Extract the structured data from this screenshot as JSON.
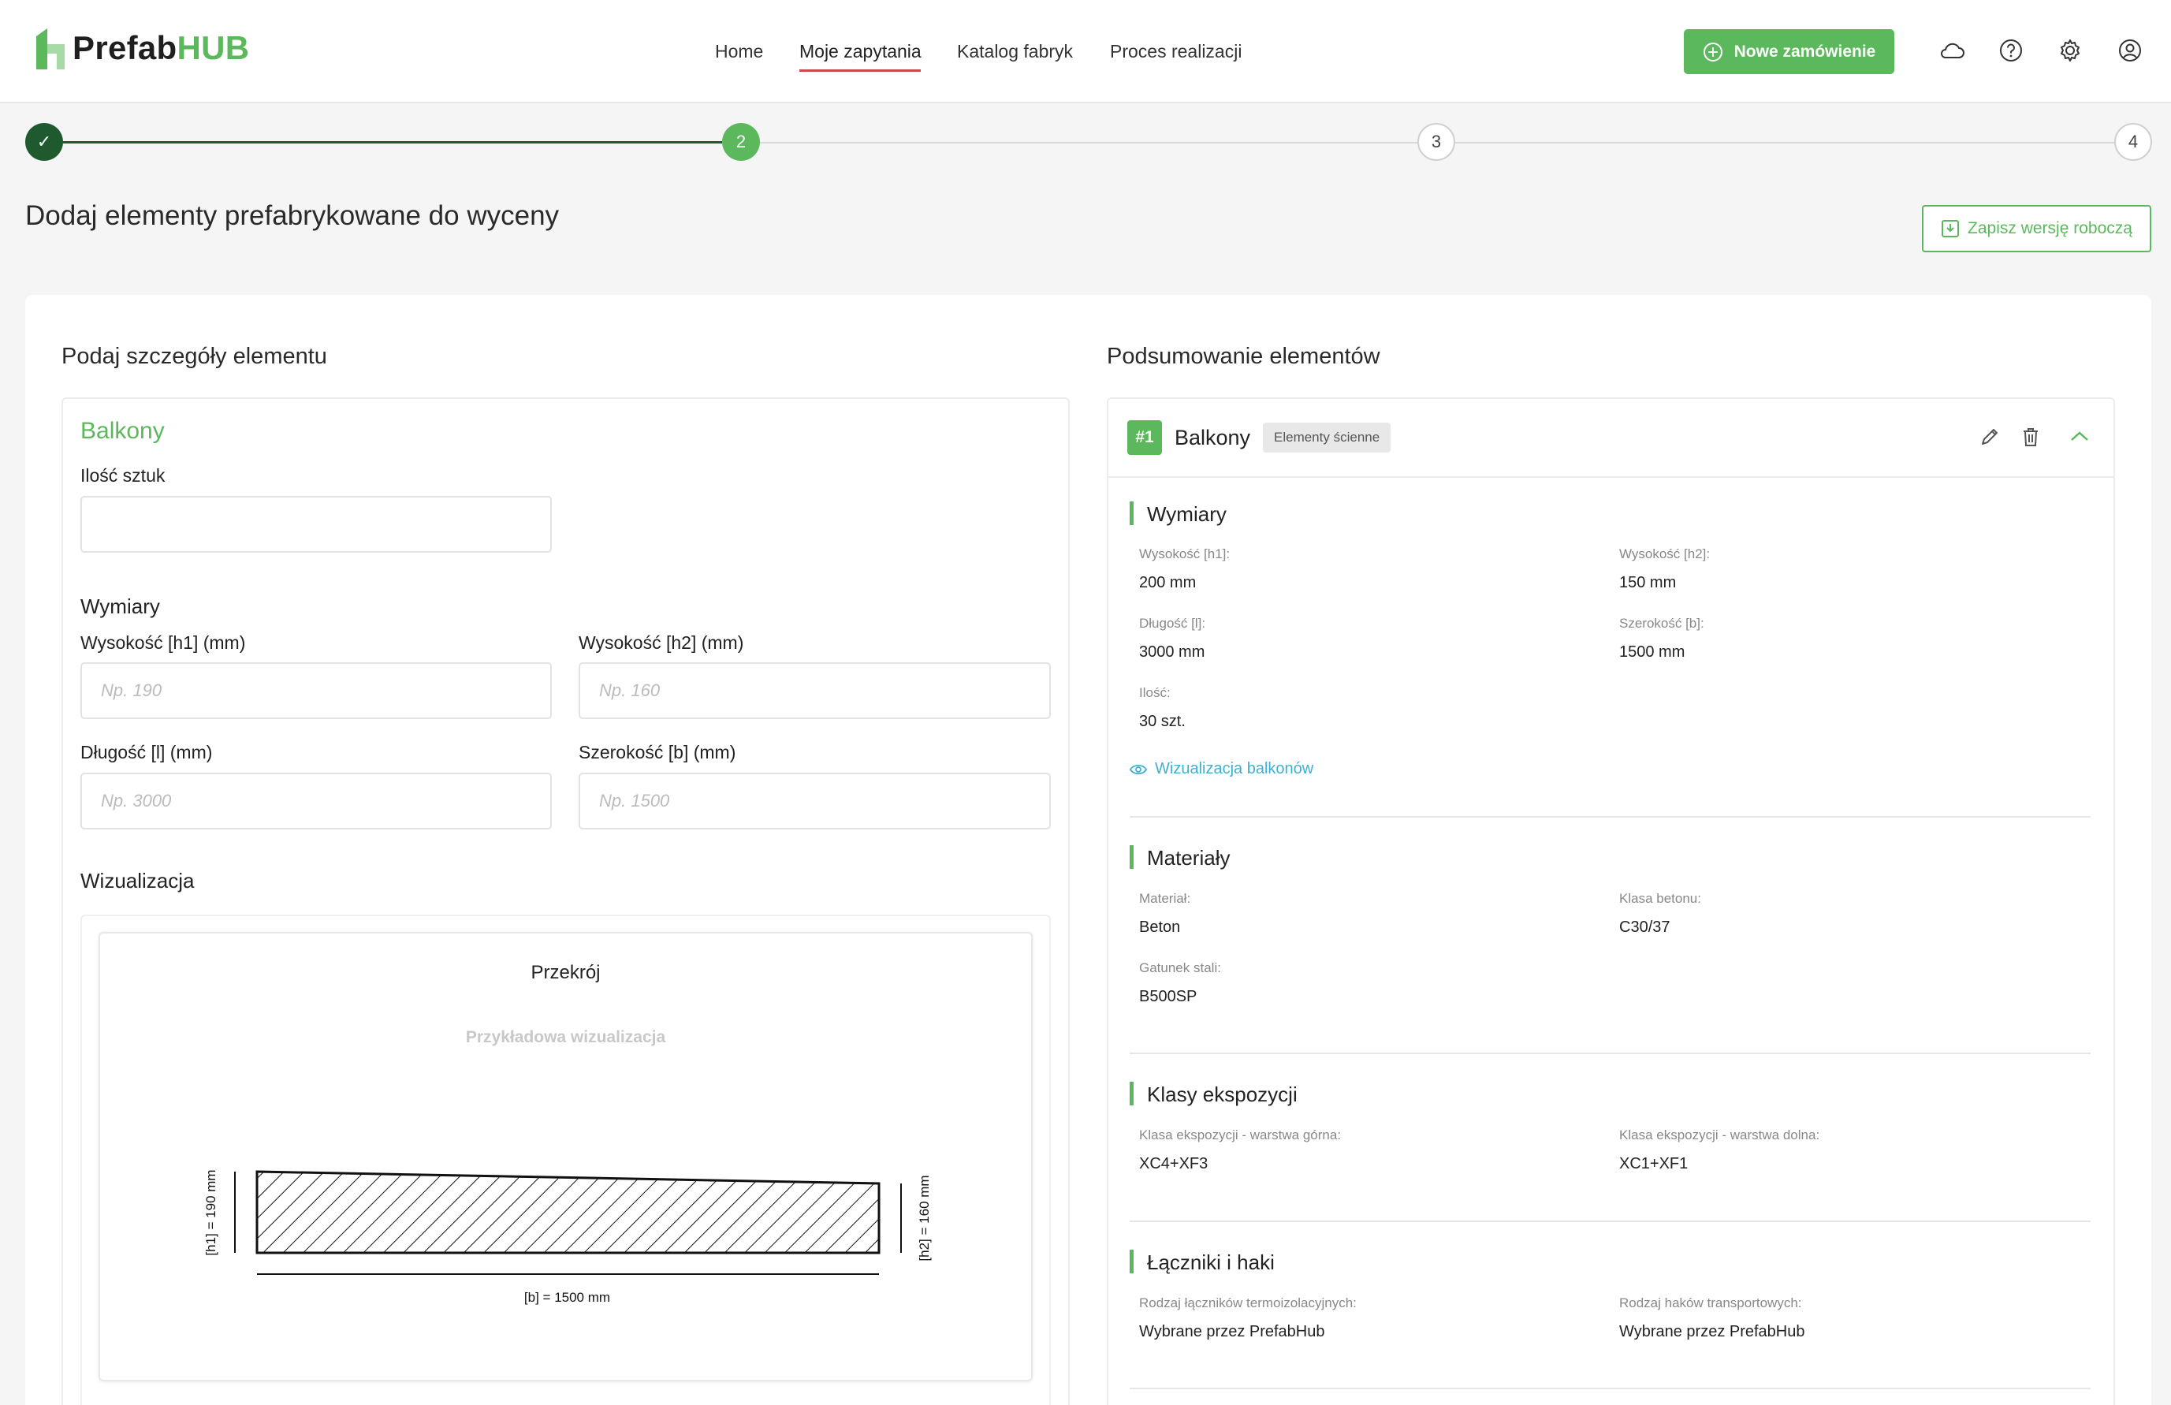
{
  "header": {
    "logo_part1": "Prefab",
    "logo_part2": "HUB",
    "nav": [
      "Home",
      "Moje zapytania",
      "Katalog fabryk",
      "Proces realizacji"
    ],
    "active_nav": "Moje zapytania",
    "new_order_label": "Nowe zamówienie"
  },
  "stepper": {
    "steps": [
      "✓",
      "2",
      "3",
      "4"
    ],
    "current": 2
  },
  "page": {
    "title": "Dodaj elementy prefabrykowane do wyceny",
    "save_draft_label": "Zapisz wersję roboczą"
  },
  "form": {
    "section_title": "Podaj szczegóły elementu",
    "element_name": "Balkony",
    "quantity_label": "Ilość sztuk",
    "quantity_value": "",
    "dimensions_title": "Wymiary",
    "h1_label": "Wysokość [h1] (mm)",
    "h1_placeholder": "Np. 190",
    "h2_label": "Wysokość [h2] (mm)",
    "h2_placeholder": "Np. 160",
    "l_label": "Długość [l] (mm)",
    "l_placeholder": "Np. 3000",
    "b_label": "Szerokość [b] (mm)",
    "b_placeholder": "Np. 1500",
    "viz_title": "Wizualizacja",
    "viz_heading": "Przekrój",
    "viz_subheading": "Przykładowa wizualizacja",
    "viz_h1": "[h1] = 190 mm",
    "viz_h2": "[h2] = 160 mm",
    "viz_b": "[b] = 1500 mm"
  },
  "summary": {
    "section_title": "Podsumowanie elementów",
    "item_number": "#1",
    "item_name": "Balkony",
    "item_tag": "Elementy ścienne",
    "dimensions": {
      "title": "Wymiary",
      "h1_key": "Wysokość [h1]:",
      "h1_val": "200 mm",
      "h2_key": "Wysokość [h2]:",
      "h2_val": "150 mm",
      "l_key": "Długość [l]:",
      "l_val": "3000 mm",
      "b_key": "Szerokość [b]:",
      "b_val": "1500 mm",
      "qty_key": "Ilość:",
      "qty_val": "30 szt.",
      "viz_link": "Wizualizacja balkonów"
    },
    "materials": {
      "title": "Materiały",
      "material_key": "Materiał:",
      "material_val": "Beton",
      "concrete_key": "Klasa betonu:",
      "concrete_val": "C30/37",
      "steel_key": "Gatunek stali:",
      "steel_val": "B500SP"
    },
    "exposure": {
      "title": "Klasy ekspozycji",
      "top_key": "Klasa ekspozycji - warstwa górna:",
      "top_val": "XC4+XF3",
      "bottom_key": "Klasa ekspozycji - warstwa dolna:",
      "bottom_val": "XC1+XF1"
    },
    "connectors": {
      "title": "Łączniki i haki",
      "thermo_key": "Rodzaj łączników termoizolacyjnych:",
      "thermo_val": "Wybrane przez PrefabHub",
      "hooks_key": "Rodzaj haków transportowych:",
      "hooks_val": "Wybrane przez PrefabHub"
    }
  },
  "colors": {
    "brand_green": "#5cb85c",
    "dark_green": "#1e5a2e",
    "nav_underline": "#c94a4a",
    "link": "#3db0d6"
  }
}
